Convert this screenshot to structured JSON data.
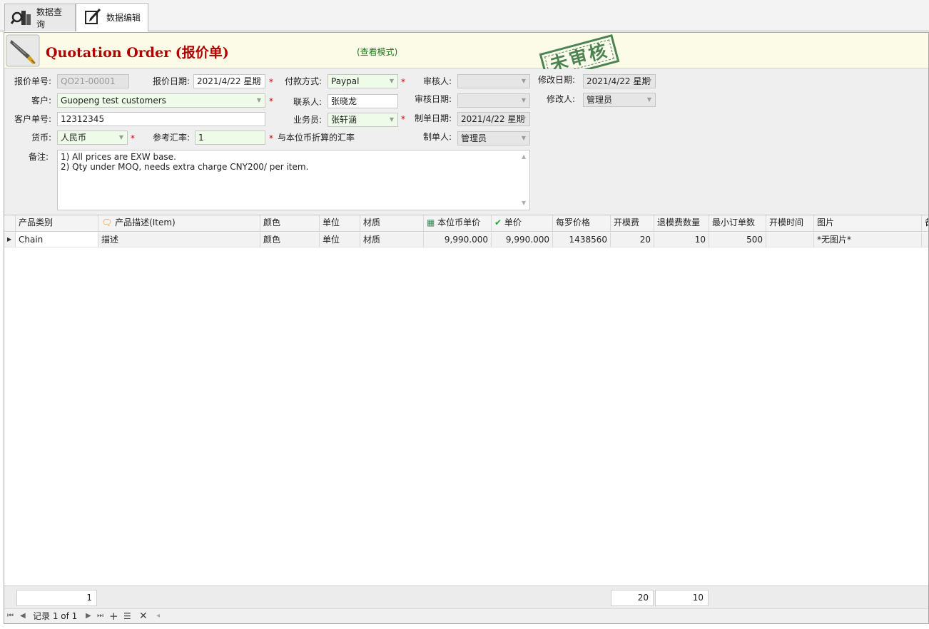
{
  "tabs": [
    {
      "label": "数据查询",
      "icon": "search-chart-icon"
    },
    {
      "label": "数据编辑",
      "icon": "edit-document-icon"
    }
  ],
  "header": {
    "title": "Quotation Order (报价单)",
    "mode": "(查看模式)",
    "stamp": "未审核"
  },
  "form": {
    "quote_no": {
      "label": "报价单号:",
      "value": "QO21-00001"
    },
    "quote_date": {
      "label": "报价日期:",
      "value": "2021/4/22 星期"
    },
    "payment": {
      "label": "付款方式:",
      "value": "Paypal"
    },
    "approver": {
      "label": "审核人:",
      "value": ""
    },
    "modify_date": {
      "label": "修改日期:",
      "value": "2021/4/22 星期"
    },
    "customer": {
      "label": "客户:",
      "value": "Guopeng test customers"
    },
    "contact": {
      "label": "联系人:",
      "value": "张晓龙"
    },
    "approve_date": {
      "label": "审核日期:",
      "value": ""
    },
    "modifier": {
      "label": "修改人:",
      "value": "管理员"
    },
    "customer_no": {
      "label": "客户单号:",
      "value": "12312345"
    },
    "salesman": {
      "label": "业务员:",
      "value": "张轩涵"
    },
    "create_date": {
      "label": "制单日期:",
      "value": "2021/4/22 星期"
    },
    "currency": {
      "label": "货币:",
      "value": "人民币"
    },
    "rate": {
      "label": "参考汇率:",
      "value": "1"
    },
    "rate_note": "与本位币折算的汇率",
    "creator": {
      "label": "制单人:",
      "value": "管理员"
    },
    "notes": {
      "label": "备注:",
      "line1": "1) All prices are EXW base.",
      "line2": "2) Qty under MOQ, needs extra charge CNY200/ per item."
    },
    "required_mark": "*"
  },
  "grid": {
    "columns": [
      "产品类别",
      "产品描述(Item)",
      "颜色",
      "单位",
      "材质",
      "本位币单价",
      "单价",
      "每罗价格",
      "开模费",
      "退模费数量",
      "最小订单数",
      "开模时间",
      "图片",
      "备"
    ],
    "row": [
      "Chain",
      "描述",
      "颜色",
      "单位",
      "材质",
      "9,990.000",
      "9,990.000",
      "1438560",
      "20",
      "10",
      "500",
      "",
      "*无图片*",
      ""
    ]
  },
  "footer": {
    "count": "1",
    "mold_fee_sum": "20",
    "return_qty_sum": "10"
  },
  "navigator": {
    "record_text": "记录 1 of 1"
  },
  "colors": {
    "title": "#b00000",
    "mode": "#1b7a1b",
    "stamp": "#2f6f3a",
    "required": "#d00000"
  }
}
